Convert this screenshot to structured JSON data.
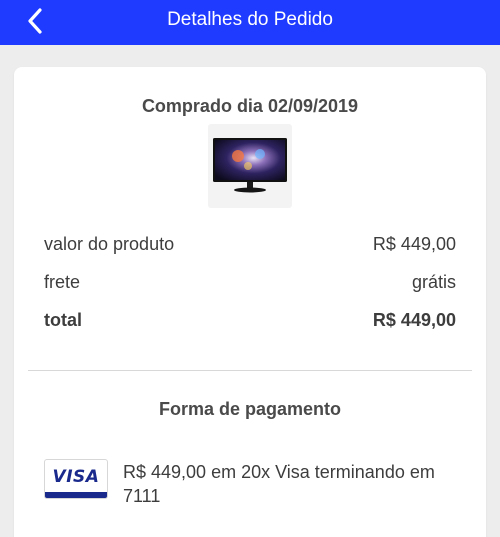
{
  "header": {
    "title": "Detalhes do Pedido",
    "background": "#1f3bff"
  },
  "order": {
    "purchase_date": "Comprado dia 02/09/2019",
    "product_image": "monitor-image",
    "rows": [
      {
        "label": "valor do produto",
        "value": "R$ 449,00"
      },
      {
        "label": "frete",
        "value": "grátis"
      },
      {
        "label": "total",
        "value": "R$ 449,00"
      }
    ]
  },
  "payment": {
    "section_title": "Forma de pagamento",
    "card_brand": "VISA",
    "description": "R$ 449,00 em 20x Visa terminando em 7111"
  }
}
